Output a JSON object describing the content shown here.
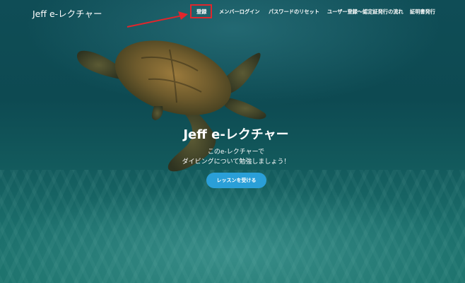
{
  "brand": "Jeff e-レクチャー",
  "nav": {
    "items": [
      {
        "label": "登録"
      },
      {
        "label": "メンバーログイン"
      },
      {
        "label": "パスワードのリセット"
      },
      {
        "label": "ユーザー登録〜認定証発行の流れ"
      },
      {
        "label": "証明書発行"
      }
    ],
    "highlighted": "登録"
  },
  "hero": {
    "title": "Jeff e-レクチャー",
    "line1": "このe-レクチャーで",
    "line2": "ダイビングについて勉強しましょう！",
    "cta_label": "レッスンを受ける"
  },
  "colors": {
    "cta": "#2a9fd8",
    "highlight": "#e0262c",
    "water": "#0f4d56"
  }
}
